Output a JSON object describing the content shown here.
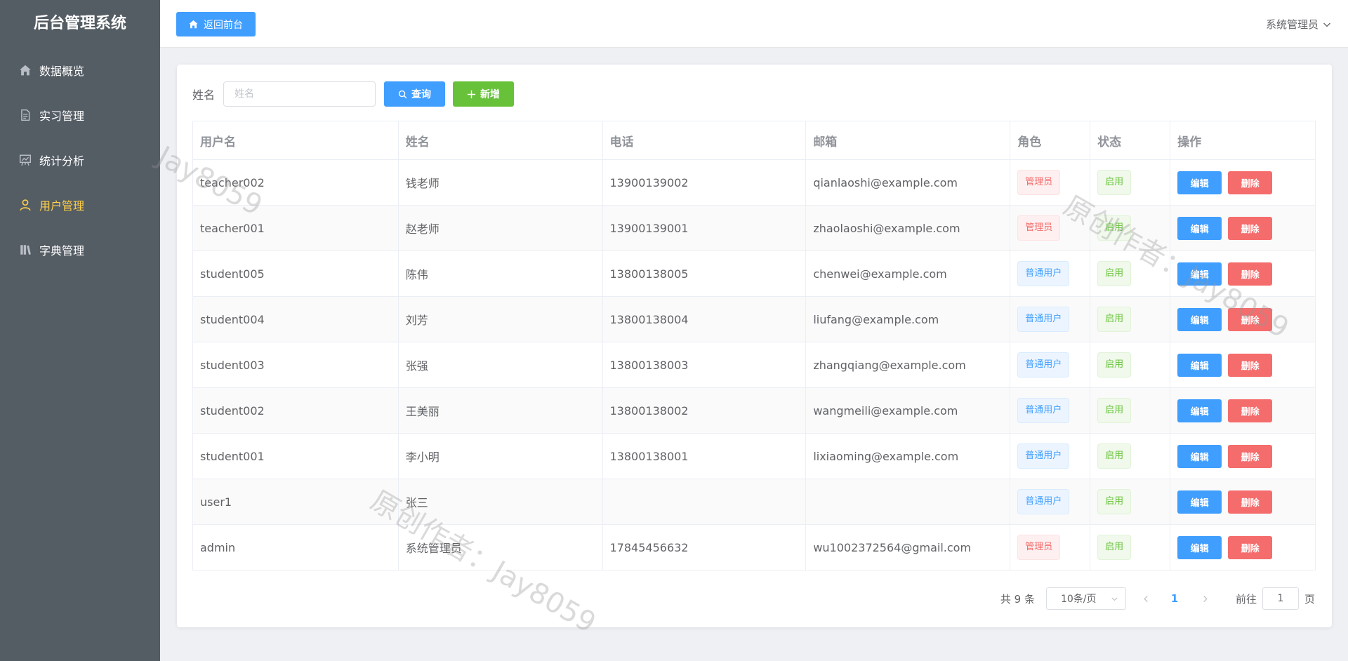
{
  "sidebar": {
    "title": "后台管理系统",
    "items": [
      {
        "label": "数据概览"
      },
      {
        "label": "实习管理"
      },
      {
        "label": "统计分析"
      },
      {
        "label": "用户管理"
      },
      {
        "label": "字典管理"
      }
    ],
    "active_index": 3
  },
  "header": {
    "back_label": "返回前台",
    "user_label": "系统管理员"
  },
  "search": {
    "label": "姓名",
    "placeholder": "姓名",
    "value": "",
    "query_label": "查询",
    "add_label": "新增"
  },
  "table": {
    "columns": [
      "用户名",
      "姓名",
      "电话",
      "邮箱",
      "角色",
      "状态",
      "操作"
    ],
    "rows": [
      {
        "username": "teacher002",
        "name": "钱老师",
        "phone": "13900139002",
        "email": "qianlaoshi@example.com",
        "role": "管理员",
        "status": "启用"
      },
      {
        "username": "teacher001",
        "name": "赵老师",
        "phone": "13900139001",
        "email": "zhaolaoshi@example.com",
        "role": "管理员",
        "status": "启用"
      },
      {
        "username": "student005",
        "name": "陈伟",
        "phone": "13800138005",
        "email": "chenwei@example.com",
        "role": "普通用户",
        "status": "启用"
      },
      {
        "username": "student004",
        "name": "刘芳",
        "phone": "13800138004",
        "email": "liufang@example.com",
        "role": "普通用户",
        "status": "启用"
      },
      {
        "username": "student003",
        "name": "张强",
        "phone": "13800138003",
        "email": "zhangqiang@example.com",
        "role": "普通用户",
        "status": "启用"
      },
      {
        "username": "student002",
        "name": "王美丽",
        "phone": "13800138002",
        "email": "wangmeili@example.com",
        "role": "普通用户",
        "status": "启用"
      },
      {
        "username": "student001",
        "name": "李小明",
        "phone": "13800138001",
        "email": "lixiaoming@example.com",
        "role": "普通用户",
        "status": "启用"
      },
      {
        "username": "user1",
        "name": "张三",
        "phone": "",
        "email": "",
        "role": "普通用户",
        "status": "启用"
      },
      {
        "username": "admin",
        "name": "系统管理员",
        "phone": "17845456632",
        "email": "wu1002372564@gmail.com",
        "role": "管理员",
        "status": "启用"
      }
    ],
    "edit_label": "编辑",
    "delete_label": "删除"
  },
  "pagination": {
    "total_text": "共 9 条",
    "page_size": "10条/页",
    "current_page": "1",
    "goto_prefix": "前往",
    "goto_value": "1",
    "goto_suffix": "页"
  },
  "watermarks": [
    "Jay8059",
    "原创作者：Jay8059",
    "原创作者：Jay8059"
  ],
  "colors": {
    "sidebar_bg": "#545c64",
    "active_menu": "#ffd04b",
    "primary": "#409eff",
    "success": "#67c23a",
    "danger": "#f56c6c"
  }
}
